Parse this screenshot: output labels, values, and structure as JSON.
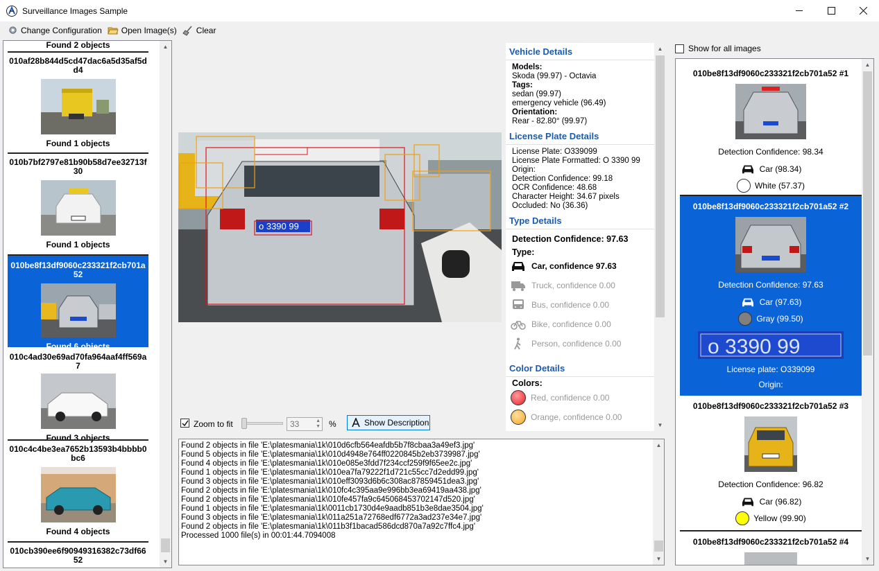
{
  "window": {
    "title": "Surveillance Images Sample"
  },
  "toolbar": {
    "change_configuration": "Change Configuration",
    "open_images": "Open Image(s)",
    "clear": "Clear"
  },
  "left_list": {
    "top_partial": "Found 2 objects",
    "items": [
      {
        "name": "010af28b844d5cd47dac6a5d35af5dd4",
        "found": "Found 1 objects",
        "selected": false
      },
      {
        "name": "010b7bf2797e81b90b58d7ee32713f30",
        "found": "Found 1 objects",
        "selected": false
      },
      {
        "name": "010be8f13df9060c233321f2cb701a52",
        "found": "Found 6 objects",
        "selected": true
      },
      {
        "name": "010c4ad30e69ad70fa964aaf4ff569a7",
        "found": "Found 3 objects",
        "selected": false
      },
      {
        "name": "010c4c4be3ea7652b13593b4bbbb0bc6",
        "found": "Found 4 objects",
        "selected": false
      },
      {
        "name": "010cb390ee6f90949316382c73df6652",
        "found": "",
        "selected": false
      }
    ]
  },
  "viewer": {
    "zoom_to_fit": "Zoom to fit",
    "zoom_value": "33",
    "percent": "%",
    "show_description": "Show Description",
    "plate_text": "o 3390 99"
  },
  "details": {
    "vehicle_header": "Vehicle Details",
    "models_label": "Models:",
    "model_value": "Skoda (99.97) - Octavia",
    "tags_label": "Tags:",
    "tag1": "sedan (99.97)",
    "tag2": "emergency vehicle (96.49)",
    "orientation_label": "Orientation:",
    "orientation_value": "Rear - 82.80° (99.97)",
    "plate_header": "License Plate Details",
    "plate_lines": [
      "License Plate: O339099",
      "License Plate Formatted: O 3390 99",
      "Origin:",
      "Detection Confidence: 99.18",
      "OCR Confidence: 48.68",
      "Character Height: 34.67 pixels",
      "Occluded: No (36.36)"
    ],
    "type_header": "Type Details",
    "detection_confidence": "Detection Confidence: 97.63",
    "type_label": "Type:",
    "types": [
      {
        "label": "Car, confidence 97.63",
        "icon": "car-icon",
        "active": true
      },
      {
        "label": "Truck, confidence 0.00",
        "icon": "truck-icon",
        "active": false
      },
      {
        "label": "Bus, confidence 0.00",
        "icon": "bus-icon",
        "active": false
      },
      {
        "label": "Bike, confidence 0.00",
        "icon": "bike-icon",
        "active": false
      },
      {
        "label": "Person, confidence 0.00",
        "icon": "person-icon",
        "active": false
      }
    ],
    "color_header": "Color Details",
    "colors_label": "Colors:",
    "colors": [
      {
        "label": "Red, confidence 0.00",
        "hex": "#e8202a"
      },
      {
        "label": "Orange, confidence 0.00",
        "hex": "#f5a623"
      }
    ]
  },
  "log": {
    "lines": [
      "Found 2 objects in file 'E:\\platesmania\\1k\\010d6cfb564eafdb5b7f8cbaa3a49ef3.jpg'",
      "Found 5 objects in file 'E:\\platesmania\\1k\\010d4948e764ff0220845b2eb3739987.jpg'",
      "Found 4 objects in file 'E:\\platesmania\\1k\\010e085e3fdd7f234ccf259f9f65ee2c.jpg'",
      "Found 1 objects in file 'E:\\platesmania\\1k\\010ea7fa79222f1d721c55cc7d2edd99.jpg'",
      "Found 3 objects in file 'E:\\platesmania\\1k\\010eff3093d6b6c308ac87859451dea3.jpg'",
      "Found 2 objects in file 'E:\\platesmania\\1k\\010fc4c395aa9e996bb3ea69419aa438.jpg'",
      "Found 2 objects in file 'E:\\platesmania\\1k\\010fe457fa9c645068453702147d520.jpg'",
      "Found 1 objects in file 'E:\\platesmania\\1k\\0011cb1730d4e9aadb851b3e8dae3504.jpg'",
      "Found 3 objects in file 'E:\\platesmania\\1k\\011a251a72768edf6772a3ad237e34e7.jpg'",
      "Found 2 objects in file 'E:\\platesmania\\1k\\011b3f1bacad586dcd870a7a92c7ffc4.jpg'",
      "Processed 1000 file(s) in 00:01:44.7094008"
    ]
  },
  "right_panel": {
    "show_for_all": "Show for all images",
    "items": [
      {
        "name": "010be8f13df9060c233321f2cb701a52 #1",
        "confidence": "Detection Confidence: 98.34",
        "type": "Car (98.34)",
        "color": "White (57.37)",
        "color_hex": "#ffffff",
        "selected": false
      },
      {
        "name": "010be8f13df9060c233321f2cb701a52 #2",
        "confidence": "Detection Confidence: 97.63",
        "type": "Car (97.63)",
        "color": "Gray (99.50)",
        "color_hex": "#808080",
        "plate": "License plate: O339099",
        "origin": "Origin:",
        "selected": true
      },
      {
        "name": "010be8f13df9060c233321f2cb701a52 #3",
        "confidence": "Detection Confidence: 96.82",
        "type": "Car (96.82)",
        "color": "Yellow (99.90)",
        "color_hex": "#ffff00",
        "selected": false
      },
      {
        "name": "010be8f13df9060c233321f2cb701a52 #4"
      }
    ]
  }
}
